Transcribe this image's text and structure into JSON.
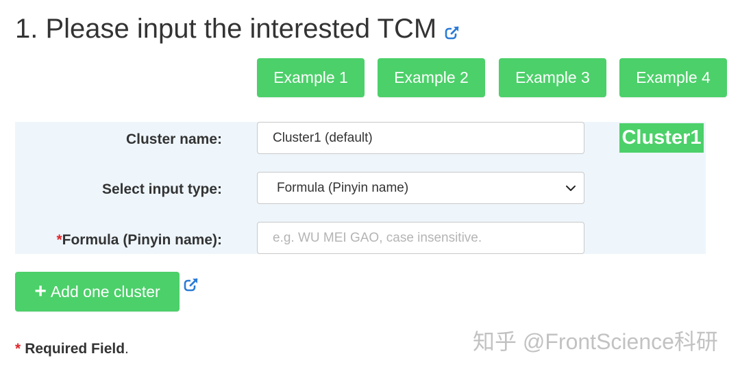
{
  "header": {
    "title": "1. Please input the interested TCM"
  },
  "examples": [
    {
      "label": "Example 1"
    },
    {
      "label": "Example 2"
    },
    {
      "label": "Example 3"
    },
    {
      "label": "Example 4"
    }
  ],
  "form": {
    "cluster_name_label": "Cluster name:",
    "cluster_name_value": "Cluster1 (default)",
    "input_type_label": "Select input type:",
    "input_type_value": "Formula (Pinyin name)",
    "formula_required_mark": "*",
    "formula_label": "Formula (Pinyin name):",
    "formula_placeholder": "e.g. WU MEI GAO, case insensitive.",
    "formula_value": ""
  },
  "cluster_badge": "Cluster1",
  "add_cluster": {
    "plus": "+",
    "label": "Add one cluster"
  },
  "footer": {
    "star": "*",
    "required_text": "Required Field",
    "period": "."
  },
  "watermark": "知乎 @FrontScience科研",
  "colors": {
    "accent_green": "#4cd06a",
    "panel_bg": "#eef6fc",
    "required_red": "#e0262a",
    "link_blue": "#2b7bd6"
  },
  "icons": {
    "title_link": "external-link-icon",
    "add_link": "external-link-icon",
    "select_arrow": "chevron-down-icon"
  }
}
